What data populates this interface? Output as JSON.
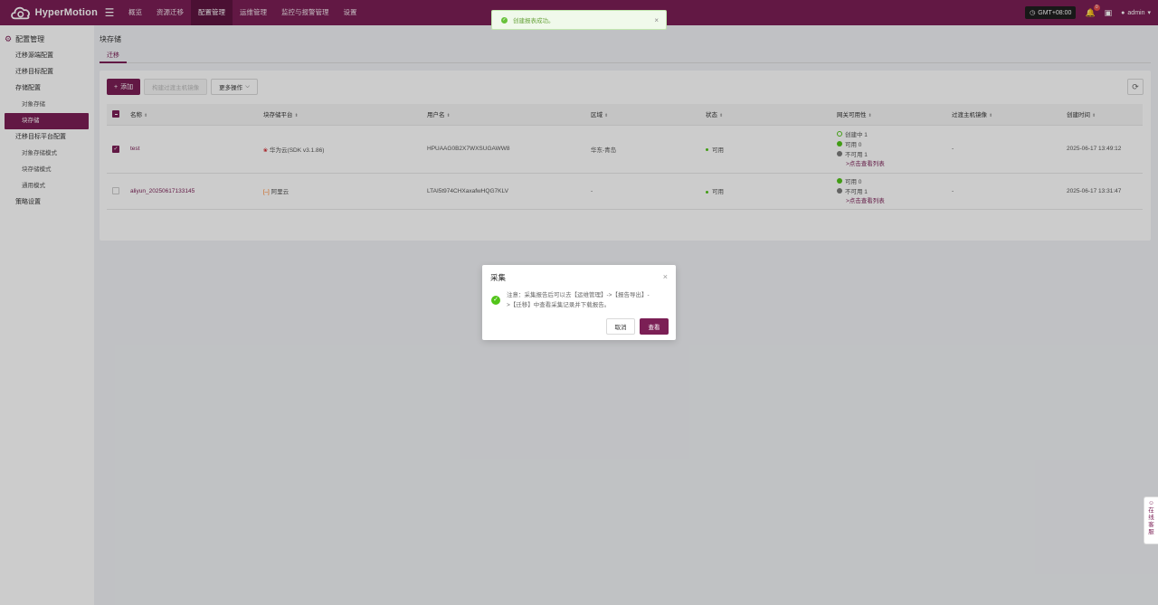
{
  "app": {
    "name": "HyperMotion"
  },
  "nav": [
    {
      "label": "概览"
    },
    {
      "label": "资源迁移"
    },
    {
      "label": "配置管理"
    },
    {
      "label": "运维管理"
    },
    {
      "label": "监控与报警管理"
    },
    {
      "label": "设置"
    }
  ],
  "topbar": {
    "timezone": "GMT+08:00",
    "bell_count": "0",
    "user": "admin"
  },
  "sidebar": {
    "header": "配置管理",
    "items": [
      {
        "label": "迁移源端配置"
      },
      {
        "label": "迁移目标配置"
      },
      {
        "label": "存储配置"
      },
      {
        "label": "对象存储"
      },
      {
        "label": "块存储"
      },
      {
        "label": "迁移目标平台配置"
      },
      {
        "label": "对象存储模式"
      },
      {
        "label": "块存储模式"
      },
      {
        "label": "通用模式"
      },
      {
        "label": "策略设置"
      }
    ]
  },
  "page": {
    "title": "块存储",
    "tab": "迁移"
  },
  "toolbar": {
    "add": "添加",
    "build_image": "构建过渡主机镜像",
    "more": "更多操作"
  },
  "table": {
    "headers": [
      "名称",
      "块存储平台",
      "用户名",
      "区域",
      "状态",
      "网关可用性",
      "过渡主机镜像",
      "创建时间"
    ],
    "rows": [
      {
        "name": "test",
        "platform": "华为云(SDK v3.1.86)",
        "username": "HPUAAG0B2X7WXSUGAWW8",
        "region": "华东-青岛",
        "status": "可用",
        "gateway": [
          "创建中 1",
          "可用 0",
          "不可用 1"
        ],
        "gateway_link": ">点击查看列表",
        "image": "-",
        "created": "2025-06-17 13:49:12"
      },
      {
        "name": "aliyun_20250617133145",
        "platform": "阿里云",
        "username": "LTAI5t974CHXaxafwHQG7KLV",
        "region": "-",
        "status": "可用",
        "gateway": [
          "可用 0",
          "不可用 1"
        ],
        "gateway_link": ">点击查看列表",
        "image": "-",
        "created": "2025-06-17 13:31:47"
      }
    ]
  },
  "toast": {
    "message": "创建报表成功。"
  },
  "dialog": {
    "title": "采集",
    "body": "注意：采集报告后可以去【运维管理】->【报告导出】->【迁移】中查看采集记录并下载报告。",
    "cancel": "取消",
    "confirm": "查看"
  },
  "float_service": {
    "label": "在线客服"
  },
  "colors": {
    "brand": "#7b1f55",
    "success": "#52c41a"
  }
}
